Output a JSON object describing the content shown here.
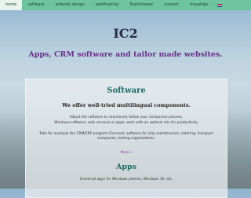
{
  "nav": {
    "items": [
      {
        "label": "home",
        "active": true
      },
      {
        "label": "software"
      },
      {
        "label": "website design"
      },
      {
        "label": "webhosting"
      },
      {
        "label": "TeamViewer"
      },
      {
        "label": "contact"
      },
      {
        "label": "traveltips"
      }
    ],
    "flag": "flag-icon"
  },
  "header": {
    "title": "IC2",
    "tagline": "Apps, CRM software and tailor made websites."
  },
  "software": {
    "heading": "Software",
    "subheading": "We offer well-tried multilingual components.",
    "line1": "Adjust the software to seamlessly follow your companies process.",
    "line2": "Windows software, web services or apps: work with an optimal mix for productivity.",
    "line3": "Take for example the CRM/ERP program iConnect, software for ship maintenance, catering, transport companies, testing organisations.",
    "more": "More »"
  },
  "apps": {
    "heading": "Apps",
    "line1": "Universal apps for Windows phones, Windows 10, etc."
  },
  "colors": {
    "nav_bg": "#6fc4a0",
    "heading": "#1d6b66",
    "tagline": "#6a2f8a"
  }
}
